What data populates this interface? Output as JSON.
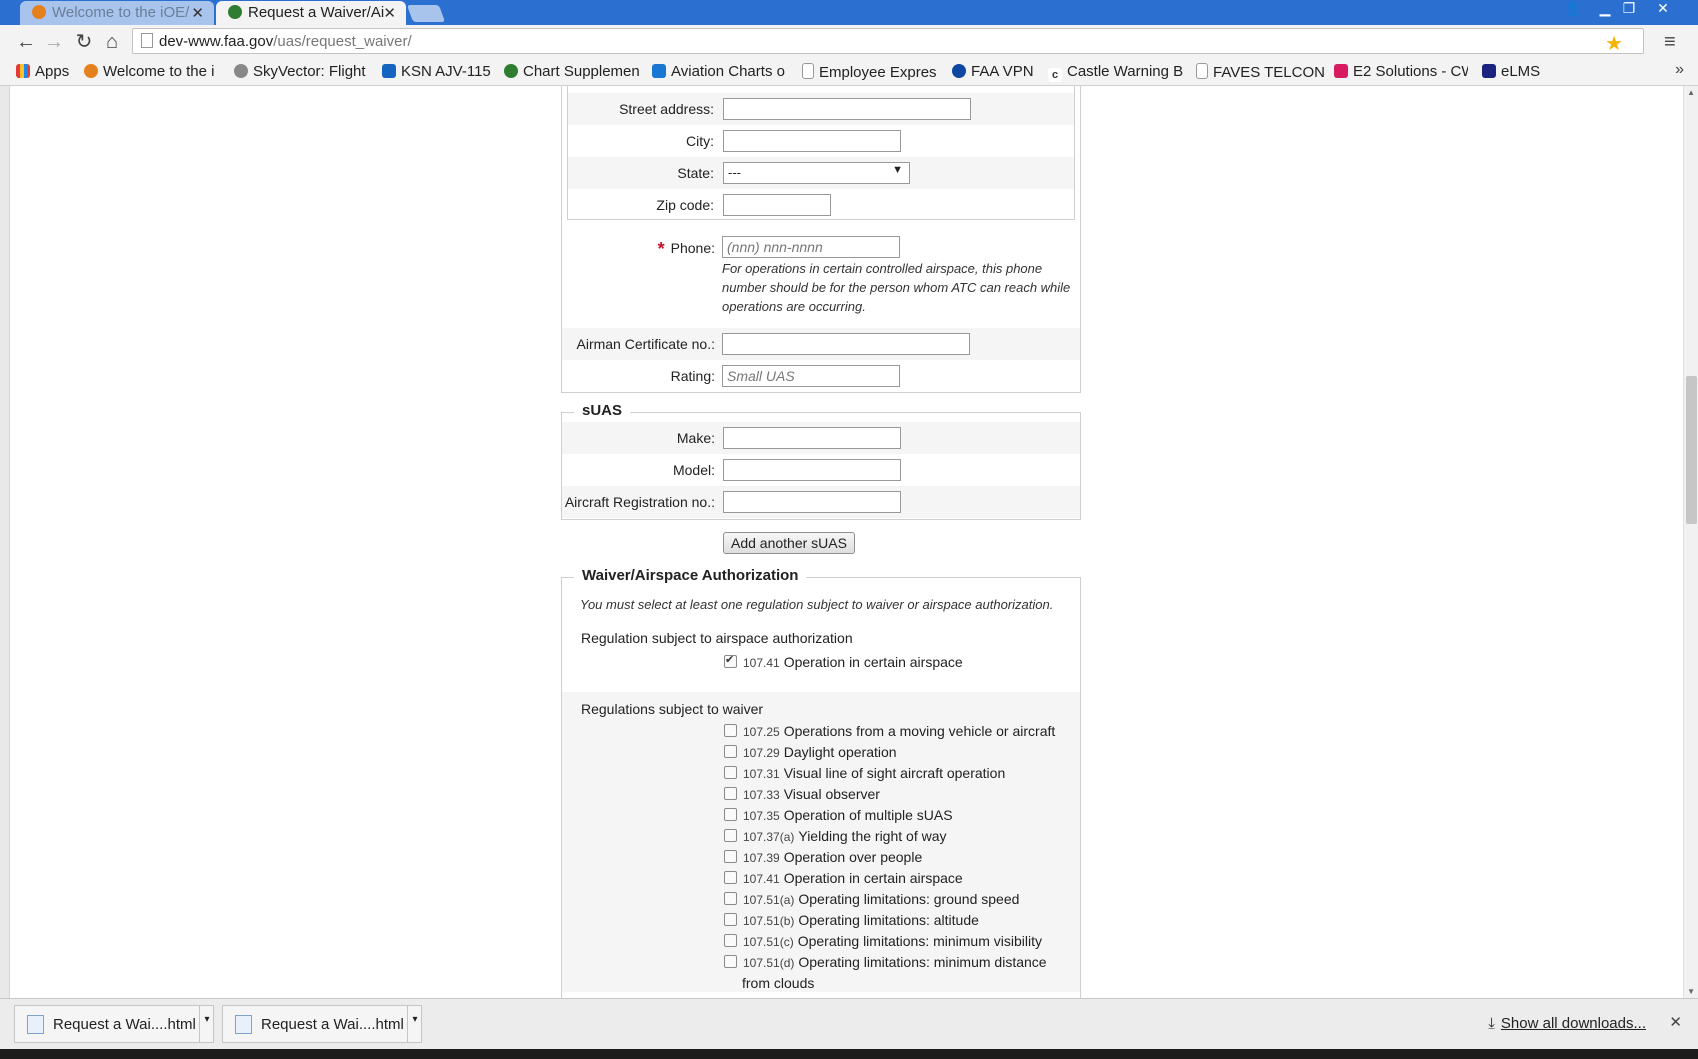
{
  "browser": {
    "tabs": [
      {
        "title": "Welcome to the iOE/",
        "active": false
      },
      {
        "title": "Request a Waiver/Ai",
        "active": true
      }
    ],
    "url_host": "dev-www.faa.gov",
    "url_path": "/uas/request_waiver/",
    "bookmarks": [
      {
        "label": "Apps",
        "icon": "apps-grid-icon"
      },
      {
        "label": "Welcome to the i",
        "icon": "ioe-icon"
      },
      {
        "label": "SkyVector: Flight",
        "icon": "skyvector-icon"
      },
      {
        "label": "KSN AJV-115",
        "icon": "sharepoint-icon"
      },
      {
        "label": "Chart Supplemen",
        "icon": "faa-seal-icon"
      },
      {
        "label": "Aviation Charts o",
        "icon": "charts-icon"
      },
      {
        "label": "Employee Expres",
        "icon": "page-icon"
      },
      {
        "label": "FAA VPN",
        "icon": "vpn-icon"
      },
      {
        "label": "Castle Warning B",
        "icon": "c-icon"
      },
      {
        "label": "FAVES TELCON",
        "icon": "page-icon"
      },
      {
        "label": "E2 Solutions - CW",
        "icon": "e2-icon"
      },
      {
        "label": "eLMS",
        "icon": "faa-icon"
      }
    ]
  },
  "form": {
    "mailing": {
      "street_label": "Street address:",
      "city_label": "City:",
      "state_label": "State:",
      "state_value": "---",
      "zip_label": "Zip code:"
    },
    "phone": {
      "label": "Phone:",
      "required_mark": "*",
      "placeholder": "(nnn) nnn-nnnn",
      "help": "For operations in certain controlled airspace, this phone number should be for the person whom ATC can reach while operations are occurring."
    },
    "airman_label": "Airman Certificate no.:",
    "rating_label": "Rating:",
    "rating_placeholder": "Small UAS",
    "suas": {
      "legend": "sUAS",
      "make_label": "Make:",
      "model_label": "Model:",
      "registration_label": "Aircraft Registration no.:",
      "add_button": "Add another sUAS"
    },
    "waiver": {
      "legend": "Waiver/Airspace Authorization",
      "note": "You must select at least one regulation subject to waiver or airspace authorization.",
      "airspace_heading": "Regulation subject to airspace authorization",
      "airspace_items": [
        {
          "code": "107.41",
          "label": "Operation in certain airspace",
          "checked": true
        }
      ],
      "waiver_heading": "Regulations subject to waiver",
      "waiver_items": [
        {
          "code": "107.25",
          "label": "Operations from a moving vehicle or aircraft",
          "checked": false
        },
        {
          "code": "107.29",
          "label": "Daylight operation",
          "checked": false
        },
        {
          "code": "107.31",
          "label": "Visual line of sight aircraft operation",
          "checked": false
        },
        {
          "code": "107.33",
          "label": "Visual observer",
          "checked": false
        },
        {
          "code": "107.35",
          "label": "Operation of multiple sUAS",
          "checked": false
        },
        {
          "code": "107.37(a)",
          "label": "Yielding the right of way",
          "checked": false
        },
        {
          "code": "107.39",
          "label": "Operation over people",
          "checked": false
        },
        {
          "code": "107.41",
          "label": "Operation in certain airspace",
          "checked": false
        },
        {
          "code": "107.51(a)",
          "label": "Operating limitations: ground speed",
          "checked": false
        },
        {
          "code": "107.51(b)",
          "label": "Operating limitations: altitude",
          "checked": false
        },
        {
          "code": "107.51(c)",
          "label": "Operating limitations: minimum visibility",
          "checked": false
        },
        {
          "code": "107.51(d)",
          "label": "Operating limitations: minimum distance",
          "label2": "from clouds",
          "checked": false
        }
      ]
    }
  },
  "downloads": {
    "items": [
      {
        "name": "Request a Wai....html"
      },
      {
        "name": "Request a Wai....html"
      }
    ],
    "show_all": "Show all downloads..."
  }
}
